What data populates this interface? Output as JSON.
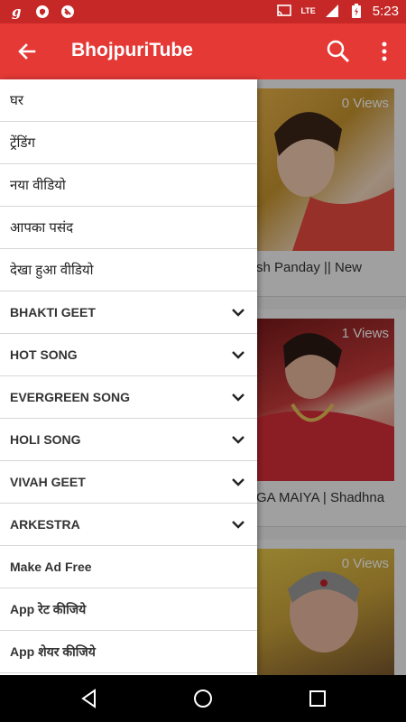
{
  "status_bar": {
    "time": "5:23",
    "lte": "LTE",
    "icons": [
      "g-icon",
      "shield-icon",
      "app-icon",
      "cast-icon",
      "signal-icon",
      "battery-icon"
    ]
  },
  "app_bar": {
    "title": "BhojpuriTube",
    "back_icon": "arrow-back-icon",
    "search_icon": "search-icon",
    "more_icon": "more-vert-icon"
  },
  "colors": {
    "status": "#c62828",
    "appbar": "#e53935",
    "drawer": "#ffffff"
  },
  "drawer": {
    "items": [
      {
        "label": "घर",
        "expandable": false
      },
      {
        "label": "ट्रेंडिंग",
        "expandable": false
      },
      {
        "label": "नया वीडियो",
        "expandable": false
      },
      {
        "label": "आपका पसंद",
        "expandable": false
      },
      {
        "label": "देखा हुआ वीडियो",
        "expandable": false
      },
      {
        "label": "BHAKTI GEET",
        "expandable": true
      },
      {
        "label": "HOT SONG",
        "expandable": true
      },
      {
        "label": "EVERGREEN SONG",
        "expandable": true
      },
      {
        "label": "HOLI SONG",
        "expandable": true
      },
      {
        "label": "VIVAH GEET",
        "expandable": true
      },
      {
        "label": "ARKESTRA",
        "expandable": true
      },
      {
        "label": "Make Ad Free",
        "expandable": false
      },
      {
        "label": "App रेट कीजिये",
        "expandable": false
      },
      {
        "label": "App शेयर कीजिये",
        "expandable": false
      }
    ]
  },
  "videos": [
    {
      "views": "0 Views",
      "title": "sh Panday || New"
    },
    {
      "views": "1 Views",
      "title": "GA MAIYA | Shadhna"
    },
    {
      "views": "0 Views",
      "title": ""
    }
  ],
  "nav_bar": {
    "back": "nav-back-icon",
    "home": "nav-home-icon",
    "recents": "nav-recents-icon"
  }
}
